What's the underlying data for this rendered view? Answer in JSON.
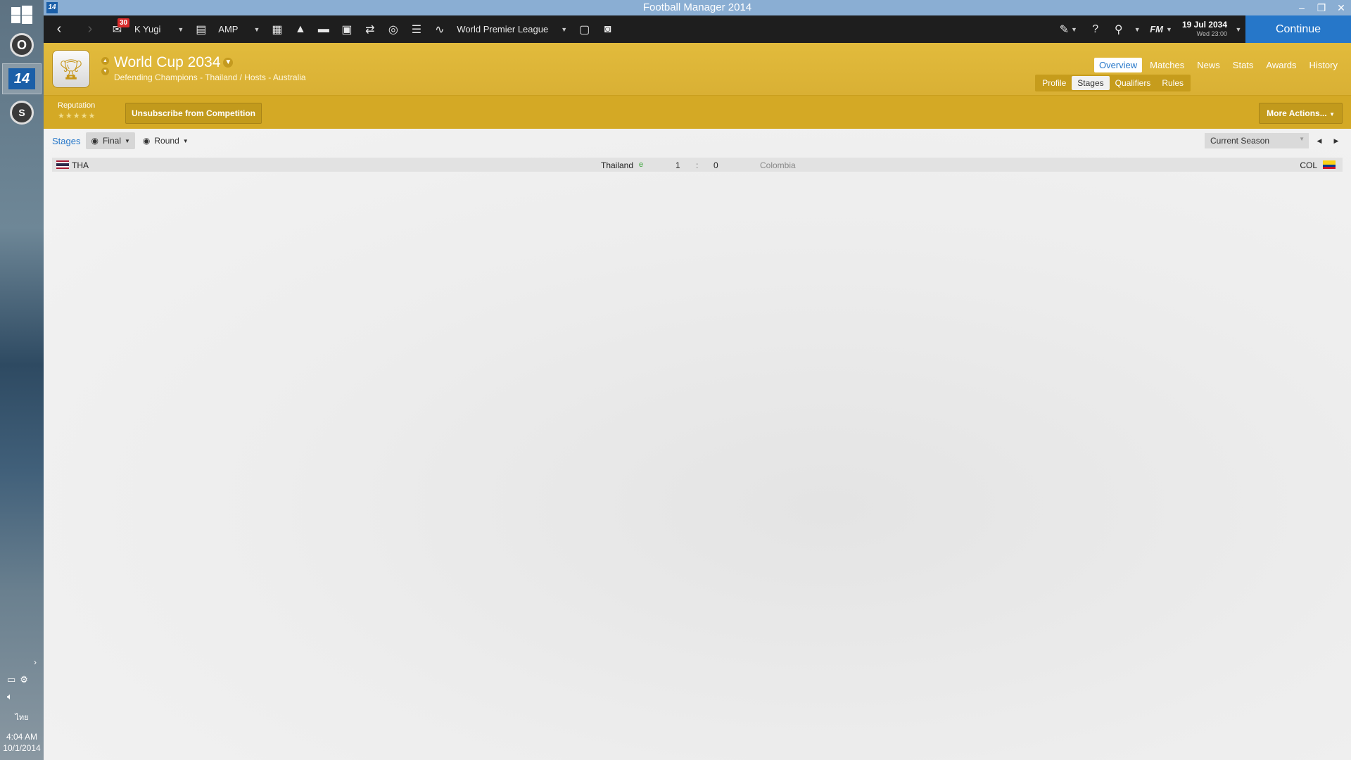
{
  "window": {
    "title": "Football Manager 2014",
    "app_icon": "14"
  },
  "taskbar": {
    "clock_time": "4:04 AM",
    "clock_date": "10/1/2014",
    "lang": "ไทย",
    "app_fm_label": "14"
  },
  "toolbar": {
    "inbox_count": "30",
    "manager": "K Yugi",
    "team": "AMP",
    "league": "World Premier League",
    "date": "19 Jul 2034",
    "time": "Wed 23:00",
    "fm_label": "FM",
    "continue_label": "Continue"
  },
  "competition": {
    "title": "World Cup 2034",
    "subtitle": "Defending Champions - Thailand / Hosts - Australia",
    "reputation_label": "Reputation",
    "reputation_stars": "★★★★★",
    "unsubscribe_label": "Unsubscribe from Competition",
    "more_actions_label": "More Actions...",
    "nav_tabs": [
      "Overview",
      "Matches",
      "News",
      "Stats",
      "Awards",
      "History"
    ],
    "sub_tabs": [
      "Profile",
      "Stages",
      "Qualifiers",
      "Rules"
    ]
  },
  "stages": {
    "breadcrumb": "Stages",
    "stage_filter": "Final",
    "round_filter": "Round",
    "season_select": "Current Season",
    "match": {
      "home_code": "THA",
      "home_name": "Thailand",
      "winner_mark": "e",
      "home_score": "1",
      "separator": ":",
      "away_score": "0",
      "away_name": "Colombia",
      "away_code": "COL"
    }
  }
}
